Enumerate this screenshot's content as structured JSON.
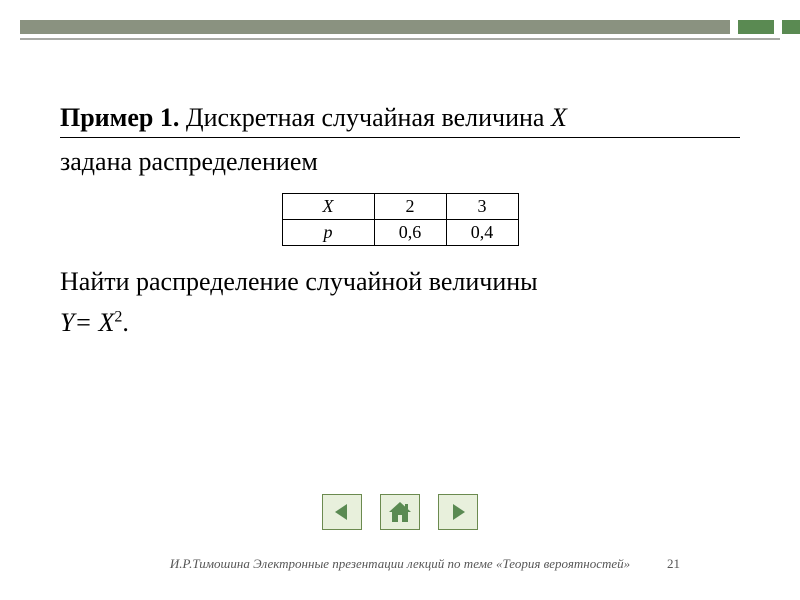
{
  "header": {
    "example_label": "Пример 1.",
    "title_rest_1": " Дискретная случайная величина ",
    "title_var": "X",
    "title_rest_2": "задана распределением"
  },
  "table": {
    "row1_label": "X",
    "row2_label": "p",
    "cols": [
      {
        "x": "2",
        "p": "0,6"
      },
      {
        "x": "3",
        "p": "0,4"
      }
    ]
  },
  "task": {
    "line1": "Найти распределение случайной величины",
    "line2_prefix": "Y= X",
    "line2_sup": "2",
    "line2_suffix": "."
  },
  "nav": {
    "prev": "previous",
    "home": "home",
    "next": "next"
  },
  "footer": {
    "text": "И.Р.Тимошина Электронные презентации лекций по теме «Теория вероятностей»",
    "page": "21"
  },
  "colors": {
    "accent_green": "#5a8a52",
    "accent_gray": "#8a9280"
  }
}
